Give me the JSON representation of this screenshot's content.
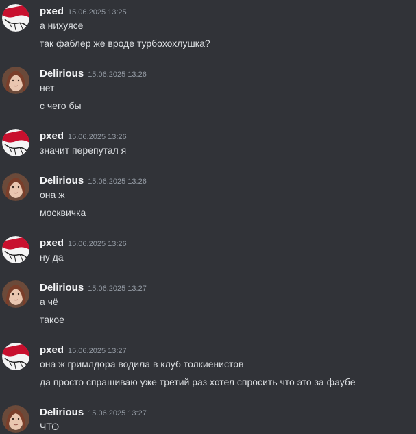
{
  "groups": [
    {
      "author": "pxed",
      "avatar": "pxed-avatar",
      "time": "15.06.2025 13:25",
      "messages": [
        "а нихуясе",
        "так фаблер же вроде турбохохлушка?"
      ]
    },
    {
      "author": "Delirious",
      "avatar": "delirious-avatar",
      "time": "15.06.2025 13:26",
      "messages": [
        "нет",
        "с чего бы"
      ]
    },
    {
      "author": "pxed",
      "avatar": "pxed-avatar",
      "time": "15.06.2025 13:26",
      "messages": [
        "значит перепутал я"
      ]
    },
    {
      "author": "Delirious",
      "avatar": "delirious-avatar",
      "time": "15.06.2025 13:26",
      "messages": [
        "она ж",
        "москвичка"
      ]
    },
    {
      "author": "pxed",
      "avatar": "pxed-avatar",
      "time": "15.06.2025 13:26",
      "messages": [
        "ну да"
      ]
    },
    {
      "author": "Delirious",
      "avatar": "delirious-avatar",
      "time": "15.06.2025 13:27",
      "messages": [
        "а чё",
        "такое"
      ]
    },
    {
      "author": "pxed",
      "avatar": "pxed-avatar",
      "time": "15.06.2025 13:27",
      "messages": [
        "она ж гримлдора водила в клуб толкиенистов",
        "да просто спрашиваю уже третий раз хотел спросить что это за фаубе"
      ]
    },
    {
      "author": "Delirious",
      "avatar": "delirious-avatar",
      "time": "15.06.2025 13:27",
      "messages": [
        "ЧТО"
      ]
    }
  ]
}
